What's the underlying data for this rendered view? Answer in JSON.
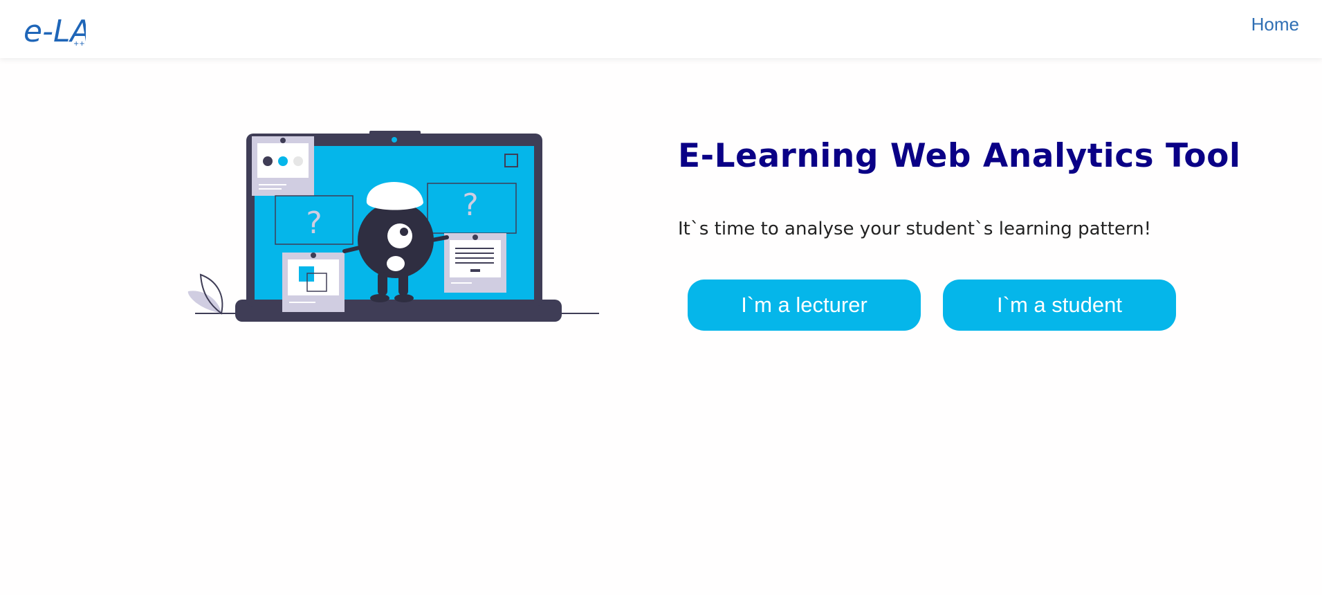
{
  "navbar": {
    "logo_text": "e-LA",
    "home_label": "Home"
  },
  "hero": {
    "title": "E-Learning Web Analytics Tool",
    "subtitle": "It`s time to analyse your student`s learning pattern!",
    "lecturer_button": "I`m a lecturer",
    "student_button": "I`m a student"
  },
  "colors": {
    "accent": "#05b6ea",
    "title": "#0a0086",
    "nav_link": "#2f6fb4",
    "logo": "#1f66b8",
    "laptop_dark": "#3f3d56"
  },
  "illustration": {
    "question_mark": "?"
  }
}
